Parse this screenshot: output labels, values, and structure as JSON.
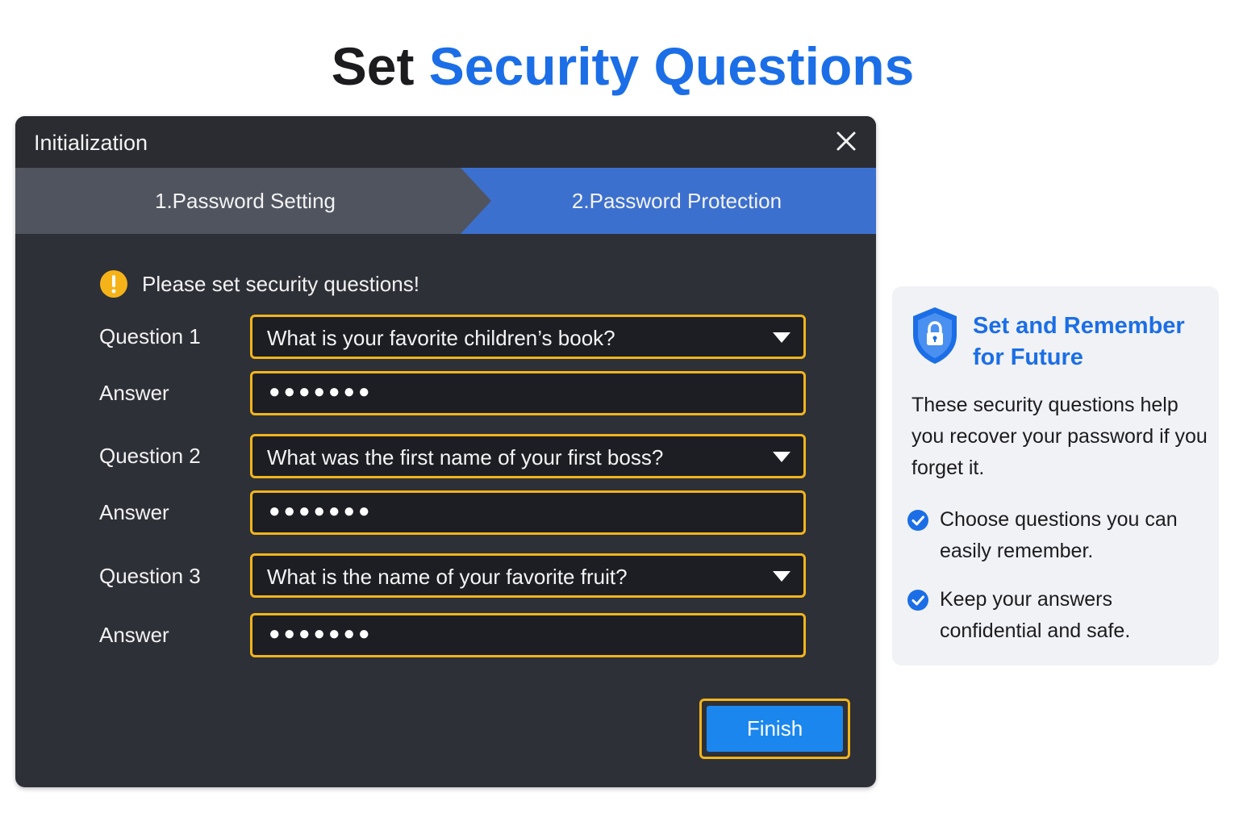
{
  "heading": {
    "part1": "Set ",
    "part2": "Security Questions"
  },
  "dialog": {
    "title": "Initialization",
    "steps": [
      {
        "label": "1.Password Setting",
        "state": "completed"
      },
      {
        "label": "2.Password Protection",
        "state": "active"
      }
    ],
    "warning": "Please set security questions!",
    "rows": [
      {
        "question_label": "Question 1",
        "question_value": "What is your favorite children’s book?",
        "answer_label": "Answer",
        "answer_value": "●●●●●●●"
      },
      {
        "question_label": "Question 2",
        "question_value": "What was the first name of your first boss?",
        "answer_label": "Answer",
        "answer_value": "●●●●●●●"
      },
      {
        "question_label": "Question 3",
        "question_value": "What is the name of your favorite fruit?",
        "answer_label": "Answer",
        "answer_value": "●●●●●●●"
      }
    ],
    "finish_label": "Finish"
  },
  "info": {
    "title": "Set and Remember for Future",
    "body": "These security questions help you recover your password if you forget it.",
    "tips": [
      "Choose questions you can easily remember.",
      "Keep your answers confidential and safe."
    ]
  },
  "colors": {
    "accent": "#1b6ee6",
    "highlight_border": "#f0b41c",
    "dialog_bg": "#2e3038",
    "active_step": "#3c70cf",
    "button": "#1b87ee"
  },
  "icons": [
    "close-icon",
    "warning-icon",
    "chevron-down-icon",
    "shield-lock-icon",
    "check-circle-icon"
  ]
}
